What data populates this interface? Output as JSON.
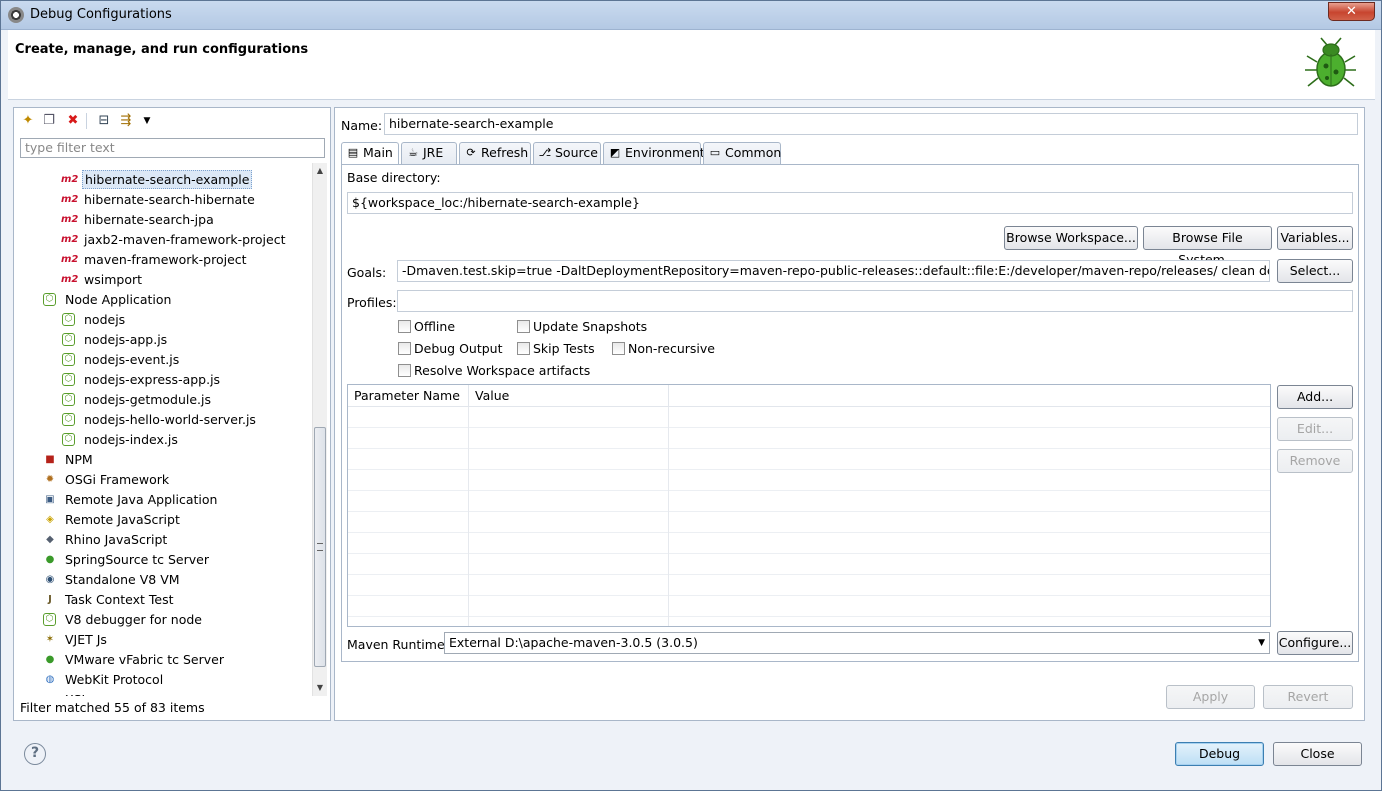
{
  "window": {
    "title": "Debug Configurations",
    "close_label": "✕"
  },
  "header": {
    "title": "Create, manage, and run configurations"
  },
  "left": {
    "filter_placeholder": "type filter text",
    "tree": [
      {
        "label": "hibernate-search-example",
        "icon": "m2",
        "level": 2,
        "selected": true
      },
      {
        "label": "hibernate-search-hibernate",
        "icon": "m2",
        "level": 2
      },
      {
        "label": "hibernate-search-jpa",
        "icon": "m2",
        "level": 2
      },
      {
        "label": "jaxb2-maven-framework-project",
        "icon": "m2",
        "level": 2
      },
      {
        "label": "maven-framework-project",
        "icon": "m2",
        "level": 2
      },
      {
        "label": "wsimport",
        "icon": "m2",
        "level": 2
      },
      {
        "label": "Node Application",
        "icon": "node",
        "level": 1
      },
      {
        "label": "nodejs",
        "icon": "node",
        "level": 2
      },
      {
        "label": "nodejs-app.js",
        "icon": "node",
        "level": 2
      },
      {
        "label": "nodejs-event.js",
        "icon": "node",
        "level": 2
      },
      {
        "label": "nodejs-express-app.js",
        "icon": "node",
        "level": 2
      },
      {
        "label": "nodejs-getmodule.js",
        "icon": "node",
        "level": 2
      },
      {
        "label": "nodejs-hello-world-server.js",
        "icon": "node",
        "level": 2
      },
      {
        "label": "nodejs-index.js",
        "icon": "node",
        "level": 2
      },
      {
        "label": "NPM",
        "icon": "npm",
        "level": 1
      },
      {
        "label": "OSGi Framework",
        "icon": "osgi",
        "level": 1
      },
      {
        "label": "Remote Java Application",
        "icon": "remote-java",
        "level": 1
      },
      {
        "label": "Remote JavaScript",
        "icon": "remote-js",
        "level": 1
      },
      {
        "label": "Rhino JavaScript",
        "icon": "rhino",
        "level": 1
      },
      {
        "label": "SpringSource tc Server",
        "icon": "spring",
        "level": 1
      },
      {
        "label": "Standalone V8 VM",
        "icon": "v8",
        "level": 1
      },
      {
        "label": "Task Context Test",
        "icon": "task",
        "level": 1
      },
      {
        "label": "V8 debugger for node",
        "icon": "node",
        "level": 1
      },
      {
        "label": "VJET Js",
        "icon": "vjet",
        "level": 1
      },
      {
        "label": "VMware vFabric tc Server",
        "icon": "spring",
        "level": 1
      },
      {
        "label": "WebKit Protocol",
        "icon": "webkit",
        "level": 1
      },
      {
        "label": "XSL",
        "icon": "xsl",
        "level": 1
      }
    ],
    "status": "Filter matched 55 of 83 items"
  },
  "right": {
    "name_label": "Name:",
    "name_value": "hibernate-search-example",
    "tabs": [
      {
        "label": "Main",
        "icon": "main",
        "active": true
      },
      {
        "label": "JRE",
        "icon": "jre"
      },
      {
        "label": "Refresh",
        "icon": "refresh"
      },
      {
        "label": "Source",
        "icon": "source"
      },
      {
        "label": "Environment",
        "icon": "environment"
      },
      {
        "label": "Common",
        "icon": "common"
      }
    ],
    "base_dir_label": "Base directory:",
    "base_dir_value": "${workspace_loc:/hibernate-search-example}",
    "browse_workspace": "Browse Workspace...",
    "browse_fs": "Browse File System...",
    "variables": "Variables...",
    "goals_label": "Goals:",
    "goals_value": "-Dmaven.test.skip=true -DaltDeploymentRepository=maven-repo-public-releases::default::file:E:/developer/maven-repo/releases/ clean deploy",
    "select_btn": "Select...",
    "profiles_label": "Profiles:",
    "profiles_value": "",
    "checkboxes": {
      "offline": "Offline",
      "update_snapshots": "Update Snapshots",
      "debug_output": "Debug Output",
      "skip_tests": "Skip Tests",
      "non_recursive": "Non-recursive",
      "resolve_workspace": "Resolve Workspace artifacts"
    },
    "param_table": {
      "columns": [
        "Parameter Name",
        "Value"
      ],
      "rows": []
    },
    "add_btn": "Add...",
    "edit_btn": "Edit...",
    "remove_btn": "Remove",
    "runtime_label": "Maven Runtime:",
    "runtime_value": "External D:\\apache-maven-3.0.5 (3.0.5)",
    "configure_btn": "Configure...",
    "apply_btn": "Apply",
    "revert_btn": "Revert"
  },
  "footer": {
    "help": "?",
    "debug_btn": "Debug",
    "close_btn": "Close"
  }
}
